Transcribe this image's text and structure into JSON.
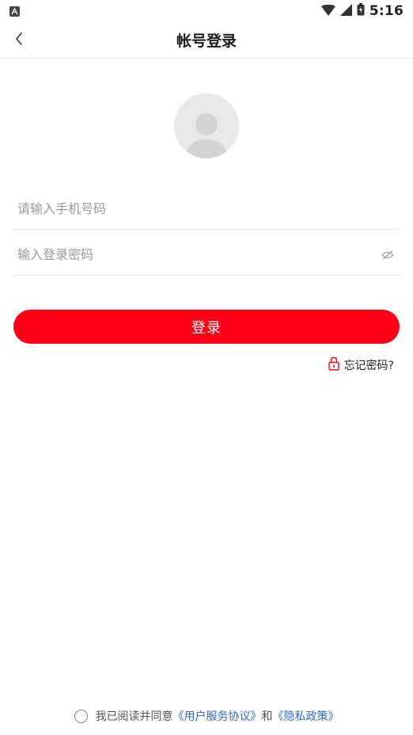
{
  "status_bar": {
    "time": "5:16",
    "icons": [
      "notification-a-icon",
      "wifi-icon",
      "cell-signal-icon",
      "battery-icon"
    ]
  },
  "header": {
    "title": "帐号登录",
    "back_icon": "chevron-left-icon"
  },
  "form": {
    "phone_placeholder": "请输入手机号码",
    "phone_value": "",
    "password_placeholder": "输入登录密码",
    "password_value": "",
    "password_visibility_icon": "eye-hidden-icon",
    "login_label": "登录",
    "forgot_label": "忘记密码?",
    "forgot_icon": "lock-icon"
  },
  "agreement": {
    "prefix": "我已阅读并同意",
    "user_agreement": "《用户服务协议》",
    "conjunction": "和",
    "privacy_policy": "《隐私政策》",
    "checked": false
  },
  "colors": {
    "primary": "#fe0018",
    "link": "#2f6bd1",
    "placeholder": "#9a9a9a",
    "divider": "#e3e3e3"
  }
}
